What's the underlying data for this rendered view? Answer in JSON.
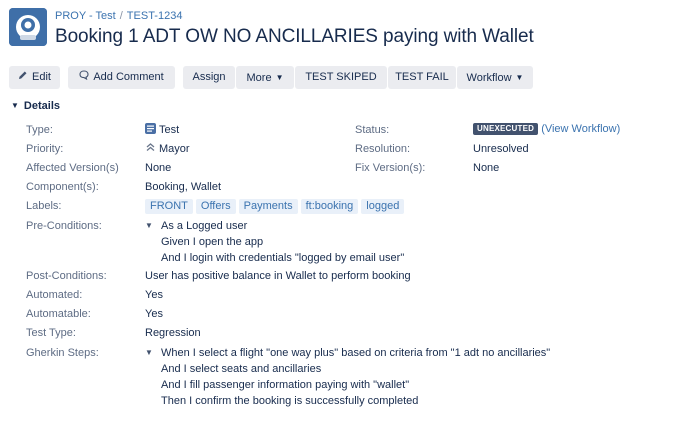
{
  "header": {
    "project": "PROY - Test",
    "separator": "/",
    "issue_key": "TEST-1234",
    "title": "Booking 1 ADT OW NO ANCILLARIES paying with Wallet"
  },
  "toolbar": {
    "edit": "Edit",
    "add_comment": "Add Comment",
    "assign": "Assign",
    "more": "More",
    "test_skiped": "TEST SKIPED",
    "test_fail": "TEST FAIL",
    "workflow": "Workflow"
  },
  "details": {
    "heading": "Details",
    "type_label": "Type:",
    "type_value": "Test",
    "priority_label": "Priority:",
    "priority_value": "Mayor",
    "affected_label": "Affected Version(s)",
    "affected_value": "None",
    "components_label": "Component(s):",
    "components_value": "Booking, Wallet",
    "labels_label": "Labels:",
    "labels": [
      "FRONT",
      "Offers",
      "Payments",
      "ft:booking",
      "logged"
    ],
    "preconditions_label": "Pre-Conditions:",
    "preconditions": [
      "As a Logged user",
      "Given I open the app",
      "And I login with credentials \"logged by email user\""
    ],
    "postconditions_label": "Post-Conditions:",
    "postconditions_value": "User has positive balance in Wallet to perform booking",
    "automated_label": "Automated:",
    "automated_value": "Yes",
    "automatable_label": "Automatable:",
    "automatable_value": "Yes",
    "testtype_label": "Test Type:",
    "testtype_value": "Regression",
    "gherkin_label": "Gherkin Steps:",
    "gherkin": [
      "When I select a flight \"one way plus\" based on criteria from \"1 adt no ancillaries\"",
      "And I select seats and ancillaries",
      "And I fill passenger information paying with \"wallet\"",
      "Then I confirm the booking is successfully completed"
    ],
    "status_label": "Status:",
    "status_value": "UNEXECUTED",
    "view_workflow": "(View Workflow)",
    "resolution_label": "Resolution:",
    "resolution_value": "Unresolved",
    "fix_label": "Fix Version(s):",
    "fix_value": "None"
  },
  "colors": {
    "link": "#3b73af",
    "button_bg": "#ebecf0",
    "lozenge_bg": "#42526e",
    "label_bg": "#e9f0f9"
  },
  "icons": {
    "project": "project-avatar-icon",
    "edit": "pencil-icon",
    "comment": "comment-bubble-icon",
    "type": "test-type-icon",
    "priority": "priority-chevrons-icon"
  }
}
